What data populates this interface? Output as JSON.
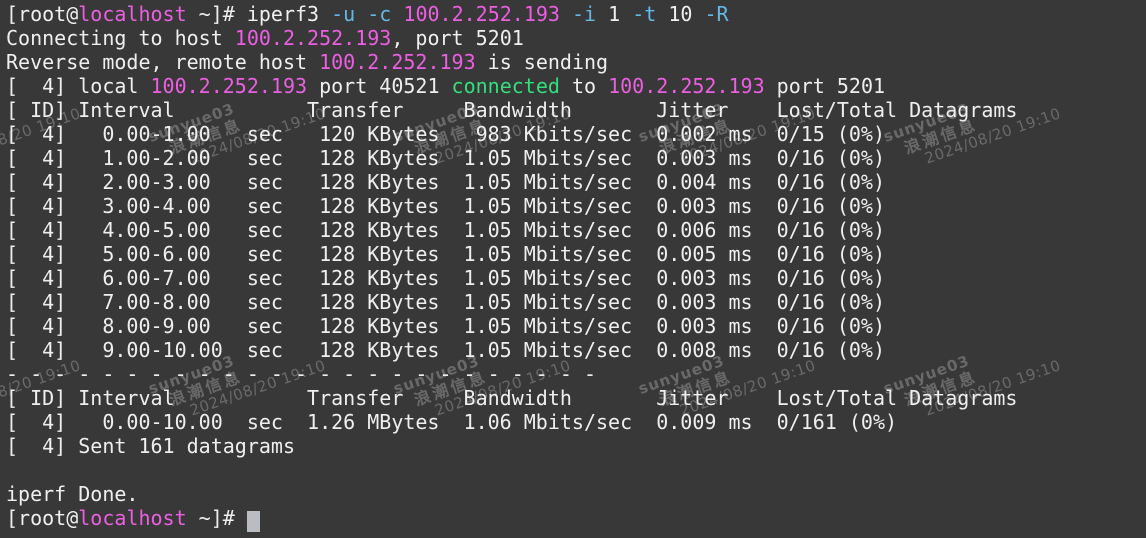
{
  "colors": {
    "background": "#383838",
    "fg": "#efefef",
    "magenta": "#ed5fe2",
    "cyan": "#62b9e8",
    "green": "#33df7d",
    "cursor": "#b9bdc2",
    "watermark": "rgba(205,205,205,0.33)"
  },
  "watermark": {
    "name": "sunyue03",
    "org": "浪潮信息",
    "datetime": "2024/08/20 19:10"
  },
  "iperf_report": {
    "command": "iperf3 -u -c 100.2.252.193 -i 1 -t 10 -R",
    "host": "100.2.252.193",
    "port": "5201",
    "local_port": "40521",
    "columns": [
      "ID",
      "Interval",
      "Transfer",
      "Bandwidth",
      "Jitter",
      "Lost/Total Datagrams"
    ],
    "sent_datagrams": "161"
  },
  "terminal": {
    "lines": [
      [
        {
          "t": "[root@"
        },
        {
          "t": "localhost",
          "c": "magenta"
        },
        {
          "t": " ~]# iperf3 "
        },
        {
          "t": "-u",
          "c": "cyan"
        },
        {
          "t": " "
        },
        {
          "t": "-c",
          "c": "cyan"
        },
        {
          "t": " "
        },
        {
          "t": "100.2.252.193",
          "c": "magenta"
        },
        {
          "t": " "
        },
        {
          "t": "-i",
          "c": "cyan"
        },
        {
          "t": " 1 "
        },
        {
          "t": "-t",
          "c": "cyan"
        },
        {
          "t": " 10 "
        },
        {
          "t": "-R",
          "c": "cyan"
        }
      ],
      [
        {
          "t": "Connecting to host "
        },
        {
          "t": "100.2.252.193",
          "c": "magenta"
        },
        {
          "t": ", port 5201"
        }
      ],
      [
        {
          "t": "Reverse mode, remote host "
        },
        {
          "t": "100.2.252.193",
          "c": "magenta"
        },
        {
          "t": " is sending"
        }
      ],
      [
        {
          "t": "[  4] local "
        },
        {
          "t": "100.2.252.193",
          "c": "magenta"
        },
        {
          "t": " port 40521 "
        },
        {
          "t": "connected",
          "c": "green"
        },
        {
          "t": " to "
        },
        {
          "t": "100.2.252.193",
          "c": "magenta"
        },
        {
          "t": " port 5201"
        }
      ],
      [
        {
          "t": "[ ID] Interval           Transfer     Bandwidth       Jitter    Lost/Total Datagrams"
        }
      ],
      [
        {
          "t": "[  4]   0.00-1.00   sec   120 KBytes   983 Kbits/sec  0.002 ms  0/15 (0%)"
        }
      ],
      [
        {
          "t": "[  4]   1.00-2.00   sec   128 KBytes  1.05 Mbits/sec  0.003 ms  0/16 (0%)"
        }
      ],
      [
        {
          "t": "[  4]   2.00-3.00   sec   128 KBytes  1.05 Mbits/sec  0.004 ms  0/16 (0%)"
        }
      ],
      [
        {
          "t": "[  4]   3.00-4.00   sec   128 KBytes  1.05 Mbits/sec  0.003 ms  0/16 (0%)"
        }
      ],
      [
        {
          "t": "[  4]   4.00-5.00   sec   128 KBytes  1.05 Mbits/sec  0.006 ms  0/16 (0%)"
        }
      ],
      [
        {
          "t": "[  4]   5.00-6.00   sec   128 KBytes  1.05 Mbits/sec  0.005 ms  0/16 (0%)"
        }
      ],
      [
        {
          "t": "[  4]   6.00-7.00   sec   128 KBytes  1.05 Mbits/sec  0.003 ms  0/16 (0%)"
        }
      ],
      [
        {
          "t": "[  4]   7.00-8.00   sec   128 KBytes  1.05 Mbits/sec  0.003 ms  0/16 (0%)"
        }
      ],
      [
        {
          "t": "[  4]   8.00-9.00   sec   128 KBytes  1.05 Mbits/sec  0.003 ms  0/16 (0%)"
        }
      ],
      [
        {
          "t": "[  4]   9.00-10.00  sec   128 KBytes  1.05 Mbits/sec  0.008 ms  0/16 (0%)"
        }
      ],
      [
        {
          "t": "- - - - - - - - - - - - - - - - - - - - - - - - -"
        }
      ],
      [
        {
          "t": "[ ID] Interval           Transfer     Bandwidth       Jitter    Lost/Total Datagrams"
        }
      ],
      [
        {
          "t": "[  4]   0.00-10.00  sec  1.26 MBytes  1.06 Mbits/sec  0.009 ms  0/161 (0%)"
        }
      ],
      [
        {
          "t": "[  4] Sent 161 datagrams"
        }
      ],
      [],
      [
        {
          "t": "iperf Done."
        }
      ],
      [
        {
          "t": "[root@"
        },
        {
          "t": "localhost",
          "c": "magenta"
        },
        {
          "t": " ~]# "
        },
        {
          "t": " ",
          "cursor": true
        }
      ]
    ]
  }
}
